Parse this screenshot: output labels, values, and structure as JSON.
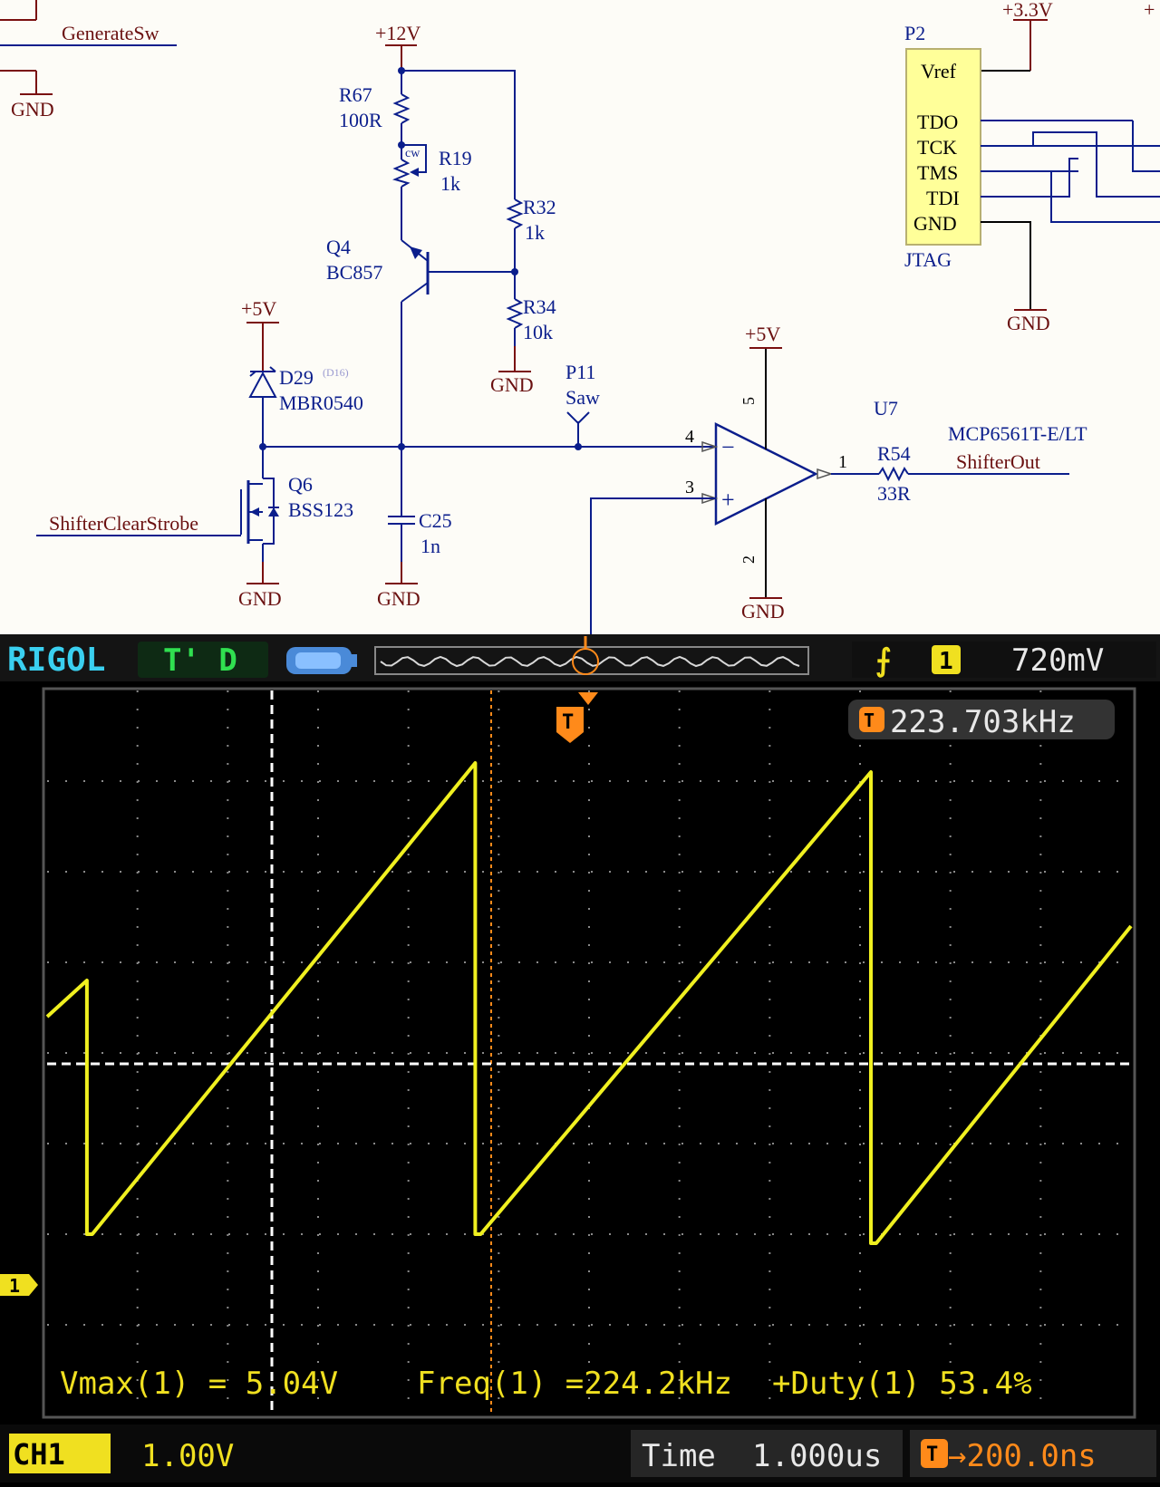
{
  "schematic": {
    "nets": {
      "generate_sw": "GenerateSw",
      "shifter_clear_strobe": "ShifterClearStrobe",
      "shifter_out": "ShifterOut",
      "saw_port": "P11",
      "saw_label": "Saw"
    },
    "power": {
      "p12v": "+12V",
      "p5v": "+5V",
      "p3v3": "+3.3V",
      "gnd": "GND"
    },
    "components": {
      "r67": {
        "ref": "R67",
        "value": "100R"
      },
      "r19": {
        "ref": "R19",
        "value": "1k",
        "cw": "cw"
      },
      "r32": {
        "ref": "R32",
        "value": "1k"
      },
      "r34": {
        "ref": "R34",
        "value": "10k"
      },
      "q4": {
        "ref": "Q4",
        "value": "BC857"
      },
      "d29": {
        "ref": "D29",
        "alt": "(D16)",
        "value": "MBR0540"
      },
      "q6": {
        "ref": "Q6",
        "value": "BSS123"
      },
      "c25": {
        "ref": "C25",
        "value": "1n"
      },
      "u7": {
        "ref": "U7",
        "value": "MCP6561T-E/LT",
        "pin4": "4",
        "pin3": "3",
        "pin5": "5",
        "pin2": "2",
        "pin1": "1",
        "minus": "−",
        "plus": "+"
      },
      "r54": {
        "ref": "R54",
        "value": "33R"
      },
      "p2": {
        "ref": "P2",
        "name": "JTAG",
        "pins": [
          "Vref",
          "TDO",
          "TCK",
          "TMS",
          "TDI",
          "GND"
        ]
      }
    },
    "colors": {
      "wire": "#0b1e8c",
      "power": "#7a1010",
      "text": "#6a1010",
      "jtag_fill": "#ffff99"
    }
  },
  "scope": {
    "brand": "RIGOL",
    "status": "T' D",
    "trigger_level": "720mV",
    "trigger_channel": "1",
    "freq_counter": "223.703kHz",
    "measurements": {
      "vmax": "Vmax(1) =  5.04V",
      "freq": "Freq(1) =224.2kHz",
      "duty": "+Duty(1) 53.4%"
    },
    "ch1_label": "CH1",
    "ch1_scale": "1.00V",
    "time_label": "Time",
    "timebase": "1.000us",
    "trigger_offset": "→200.0ns",
    "trigger_marker": "T",
    "channel_marker": "1",
    "colors": {
      "trace": "#f0f020",
      "brand": "#3ad0f0",
      "status": "#30e050",
      "accent": "#ff8a1a",
      "grid": "#9a9a9a"
    }
  },
  "chart_data": {
    "type": "line",
    "title": "",
    "xlabel": "",
    "ylabel": "",
    "x_unit": "us",
    "y_unit": "V",
    "time_per_div": 1.0,
    "volts_per_div": 1.0,
    "xlim": [
      -2.5,
      9.5
    ],
    "ylim": [
      -2.2,
      5.8
    ],
    "grid": true,
    "series": [
      {
        "name": "CH1",
        "x": [
          -2.5,
          -2.06,
          -2.06,
          -2.0,
          2.24,
          2.24,
          2.3,
          6.62,
          6.62,
          6.68,
          9.5
        ],
        "y": [
          2.2,
          2.6,
          -0.2,
          -0.2,
          5.0,
          -0.2,
          -0.2,
          4.9,
          -0.3,
          -0.3,
          3.2
        ]
      }
    ]
  }
}
